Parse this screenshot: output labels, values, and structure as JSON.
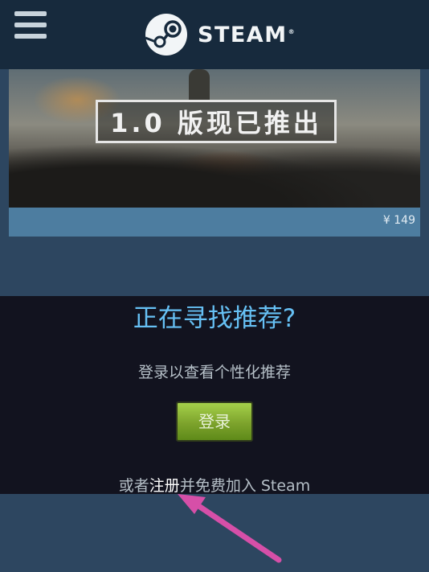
{
  "header": {
    "brand": "STEAM",
    "trademark": "®",
    "logo_icon": "steam-logo-icon",
    "menu_icon": "hamburger-menu-icon"
  },
  "banner": {
    "headline": "1.0 版现已推出",
    "price": "¥ 149"
  },
  "recommendations": {
    "title": "正在寻找推荐?",
    "subtitle": "登录以查看个性化推荐",
    "login_label": "登录",
    "join_prefix": "或者",
    "register_link": "注册",
    "join_suffix": "并免费加入 Steam"
  },
  "colors": {
    "header_bg": "#172a3d",
    "page_bg": "#2d4660",
    "rec_bg": "#12131f",
    "accent_blue": "#66c0f4",
    "login_green": "#7da32c",
    "annotation_arrow": "#d64fa8"
  }
}
